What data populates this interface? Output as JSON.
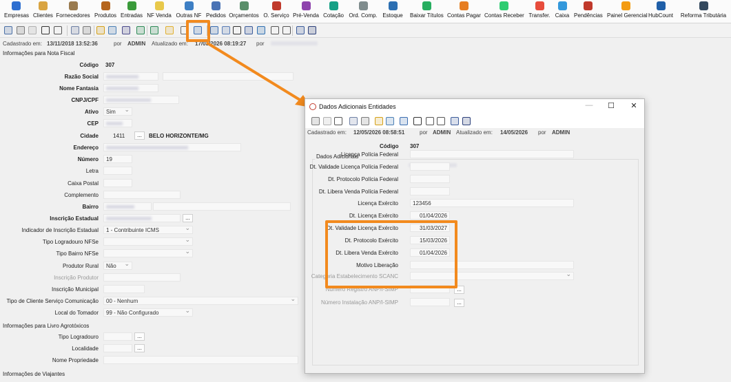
{
  "ribbon": [
    {
      "label": "Empresas",
      "icon": "company-icon",
      "color": "#2e6fd0"
    },
    {
      "label": "Clientes",
      "icon": "clients-icon",
      "color": "#d9a441"
    },
    {
      "label": "Fornecedores",
      "icon": "suppliers-icon",
      "color": "#9a7b4f"
    },
    {
      "label": "Produtos",
      "icon": "products-icon",
      "color": "#b5651d"
    },
    {
      "label": "Entradas",
      "icon": "entries-icon",
      "color": "#3a9a3a"
    },
    {
      "label": "NF Venda",
      "icon": "invoice-icon",
      "color": "#e8c84a"
    },
    {
      "label": "Outras NF",
      "icon": "other-invoice-icon",
      "color": "#3d7fc4"
    },
    {
      "label": "Pedidos",
      "icon": "orders-icon",
      "color": "#4a73b5"
    },
    {
      "label": "Orçamentos",
      "icon": "quotes-icon",
      "color": "#5a8f6a"
    },
    {
      "label": "O. Serviço",
      "icon": "service-order-icon",
      "color": "#c0392b"
    },
    {
      "label": "Pré-Venda",
      "icon": "pre-sale-icon",
      "color": "#8e44ad"
    },
    {
      "label": "Cotação",
      "icon": "quotation-icon",
      "color": "#16a085"
    },
    {
      "label": "Ord. Comp.",
      "icon": "purchase-order-icon",
      "color": "#7f8c8d"
    },
    {
      "label": "Estoque",
      "icon": "stock-icon",
      "color": "#2c6fb2"
    },
    {
      "label": "Baixar Títulos",
      "icon": "settle-titles-icon",
      "color": "#27ae60"
    },
    {
      "label": "Contas Pagar",
      "icon": "payables-icon",
      "color": "#e67e22"
    },
    {
      "label": "Contas Receber",
      "icon": "receivables-icon",
      "color": "#2ecc71"
    },
    {
      "label": "Transfer.",
      "icon": "transfer-icon",
      "color": "#e74c3c"
    },
    {
      "label": "Caixa",
      "icon": "cashier-icon",
      "color": "#3498db"
    },
    {
      "label": "Pendências",
      "icon": "pending-icon",
      "color": "#c0392b"
    },
    {
      "label": "Painel Gerencial",
      "icon": "dashboard-icon",
      "color": "#f39c12"
    },
    {
      "label": "HubCount",
      "icon": "hubcount-icon",
      "color": "#1f5fa8"
    },
    {
      "label": "Reforma Tributária",
      "icon": "tax-reform-icon",
      "color": "#34495e"
    }
  ],
  "info": {
    "created_label": "Cadastrado em:",
    "created": "13/11/2018 13:52:36",
    "por1": "por",
    "user1": "ADMIN",
    "updated_label": "Atualizado em:",
    "updated": "17/03/2026 08:19:27",
    "por2": "por"
  },
  "sections": {
    "nf": "Informações para Nota Fiscal",
    "agro": "Informações para Livro Agrotóxicos",
    "viaj": "Informações de Viajantes"
  },
  "form": {
    "codigo_label": "Código",
    "codigo": "307",
    "razao_label": "Razão Social",
    "fantasia_label": "Nome Fantasia",
    "cnpj_label": "CNPJ/CPF",
    "ativo_label": "Ativo",
    "ativo": "Sim",
    "cep_label": "CEP",
    "cidade_label": "Cidade",
    "cidade_code": "1411",
    "cidade_name": "BELO HORIZONTE/MG",
    "endereco_label": "Endereço",
    "numero_label": "Número",
    "numero": "19",
    "letra_label": "Letra",
    "caixa_label": "Caixa Postal",
    "complemento_label": "Complemento",
    "bairro_label": "Bairro",
    "ie_label": "Inscrição Estadual",
    "ind_ie_label": "Indicador de Inscrição Estadual",
    "ind_ie": "1 - Contribuinte ICMS",
    "tipo_log_label": "Tipo Logradouro NFSe",
    "tipo_bairro_label": "Tipo Bairro NFSe",
    "prod_rural_label": "Produtor Rural",
    "prod_rural": "Não",
    "insc_prod_label": "Inscrição Produtor",
    "insc_mun_label": "Inscrição Municipal",
    "tipo_cli_label": "Tipo de Cliente Serviço Comunicação",
    "tipo_cli": "00 - Nenhum",
    "local_tom_label": "Local do Tomador",
    "local_tom": "99 - Não Configurado",
    "agro_tipo_log_label": "Tipo Logradouro",
    "agro_localidade_label": "Localidade",
    "agro_nome_prop_label": "Nome Propriedade",
    "dots": "..."
  },
  "dialog": {
    "title": "Dados Adicionais Entidades",
    "min": "—",
    "max": "☐",
    "close": "✕",
    "created_label": "Cadastrado em:",
    "created": "12/05/2026 08:58:51",
    "por1": "por",
    "user1": "ADMIN",
    "updated_label": "Atualizado em:",
    "updated": "14/05/2026",
    "por2": "por",
    "user2": "ADMIN",
    "codigo_label": "Código",
    "codigo": "307",
    "group_label": "Dados Adicionais",
    "fields": {
      "lic_pf_label": "Licença Polícia Federal",
      "dt_val_pf_label": "Dt. Validade Licença Polícia Federal",
      "dt_prot_pf_label": "Dt. Protocolo Polícia Federal",
      "dt_lib_pf_label": "Dt. Libera Venda Polícia Federal",
      "lic_ex_label": "Licença Exército",
      "lic_ex": "123456",
      "dt_lic_ex_label": "Dt. Licença Exército",
      "dt_lic_ex": "01/04/2026",
      "dt_val_ex_label": "Dt. Validade Licença Exército",
      "dt_val_ex": "31/03/2027",
      "dt_prot_ex_label": "Dt. Protocolo Exército",
      "dt_prot_ex": "15/03/2026",
      "dt_lib_ex_label": "Dt. Libera Venda Exército",
      "dt_lib_ex": "01/04/2026",
      "motivo_label": "Motivo Liberação",
      "categoria_label": "Categoria Estabelecimento SCANC",
      "anp_reg_label": "Número Registro ANP/I-SIMP",
      "anp_inst_label": "Número Instalação ANP/I-SIMP",
      "dots": "..."
    }
  },
  "colors": {
    "accent": "#f28a1e",
    "window_bg": "#f0f0f0"
  }
}
